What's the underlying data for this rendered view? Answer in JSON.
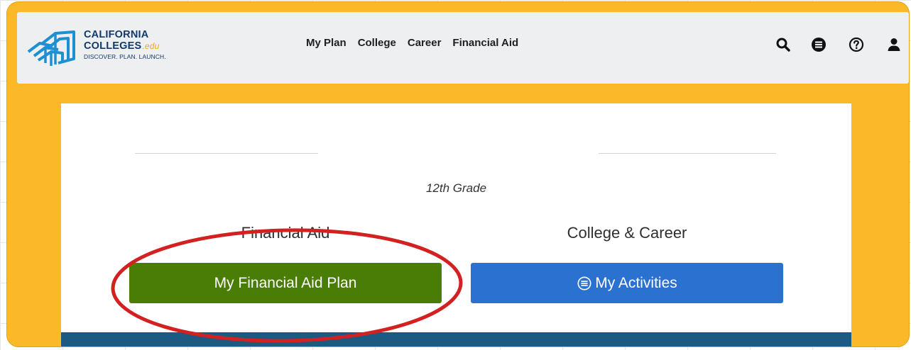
{
  "logo": {
    "line1": "CALIFORNIA",
    "line2": "COLLEGES",
    "domain_suffix": ".edu",
    "tagline": "DISCOVER. PLAN. LAUNCH."
  },
  "nav": [
    "My Plan",
    "College",
    "Career",
    "Financial Aid"
  ],
  "header_icons": [
    "search-icon",
    "list-icon",
    "help-icon",
    "user-icon"
  ],
  "main": {
    "grade": "12th Grade",
    "financial_aid_label": "Financial Aid",
    "college_career_label": "College & Career",
    "financial_aid_button": "My Financial Aid Plan",
    "activities_button": "My Activities"
  },
  "colors": {
    "frame": "#fbb829",
    "brand_navy": "#12396b",
    "green_button": "#4a7d05",
    "blue_button": "#2b72d0",
    "annotation_circle": "#d32020",
    "panel_footer": "#1c5a82"
  }
}
